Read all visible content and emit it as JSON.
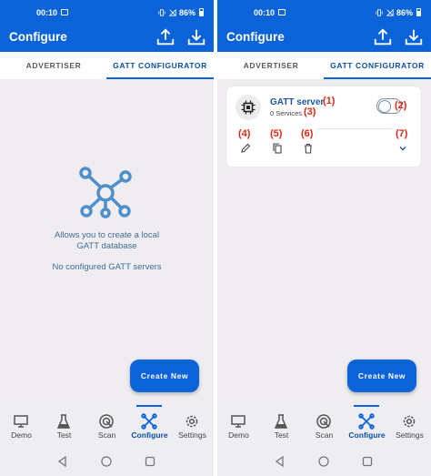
{
  "status": {
    "time": "00:10",
    "battery": "86%"
  },
  "appbar": {
    "title": "Configure",
    "upload_icon": "upload-icon",
    "download_icon": "download-icon"
  },
  "tabs": [
    {
      "label": "ADVERTISER",
      "active": false
    },
    {
      "label": "GATT CONFIGURATOR",
      "active": true
    }
  ],
  "empty_state": {
    "line1": "Allows you to create a local",
    "line2": "GATT database",
    "no_servers": "No configured GATT servers"
  },
  "server_card": {
    "name": "GATT server",
    "services": "0 Services",
    "toggle_on": false,
    "annotations": {
      "name": "(1)",
      "toggle": "(2)",
      "services": "(3)",
      "edit": "(4)",
      "copy": "(5)",
      "delete": "(6)",
      "expand": "(7)"
    }
  },
  "fab_label": "Create New",
  "bottom_nav": [
    {
      "label": "Demo",
      "icon": "monitor-icon",
      "active": false
    },
    {
      "label": "Test",
      "icon": "flask-icon",
      "active": false
    },
    {
      "label": "Scan",
      "icon": "radar-icon",
      "active": false
    },
    {
      "label": "Configure",
      "icon": "configure-icon",
      "active": true
    },
    {
      "label": "Settings",
      "icon": "gear-icon",
      "active": false
    }
  ],
  "colors": {
    "primary": "#0a63d9",
    "annotation": "#e02818",
    "background": "#efedef"
  }
}
